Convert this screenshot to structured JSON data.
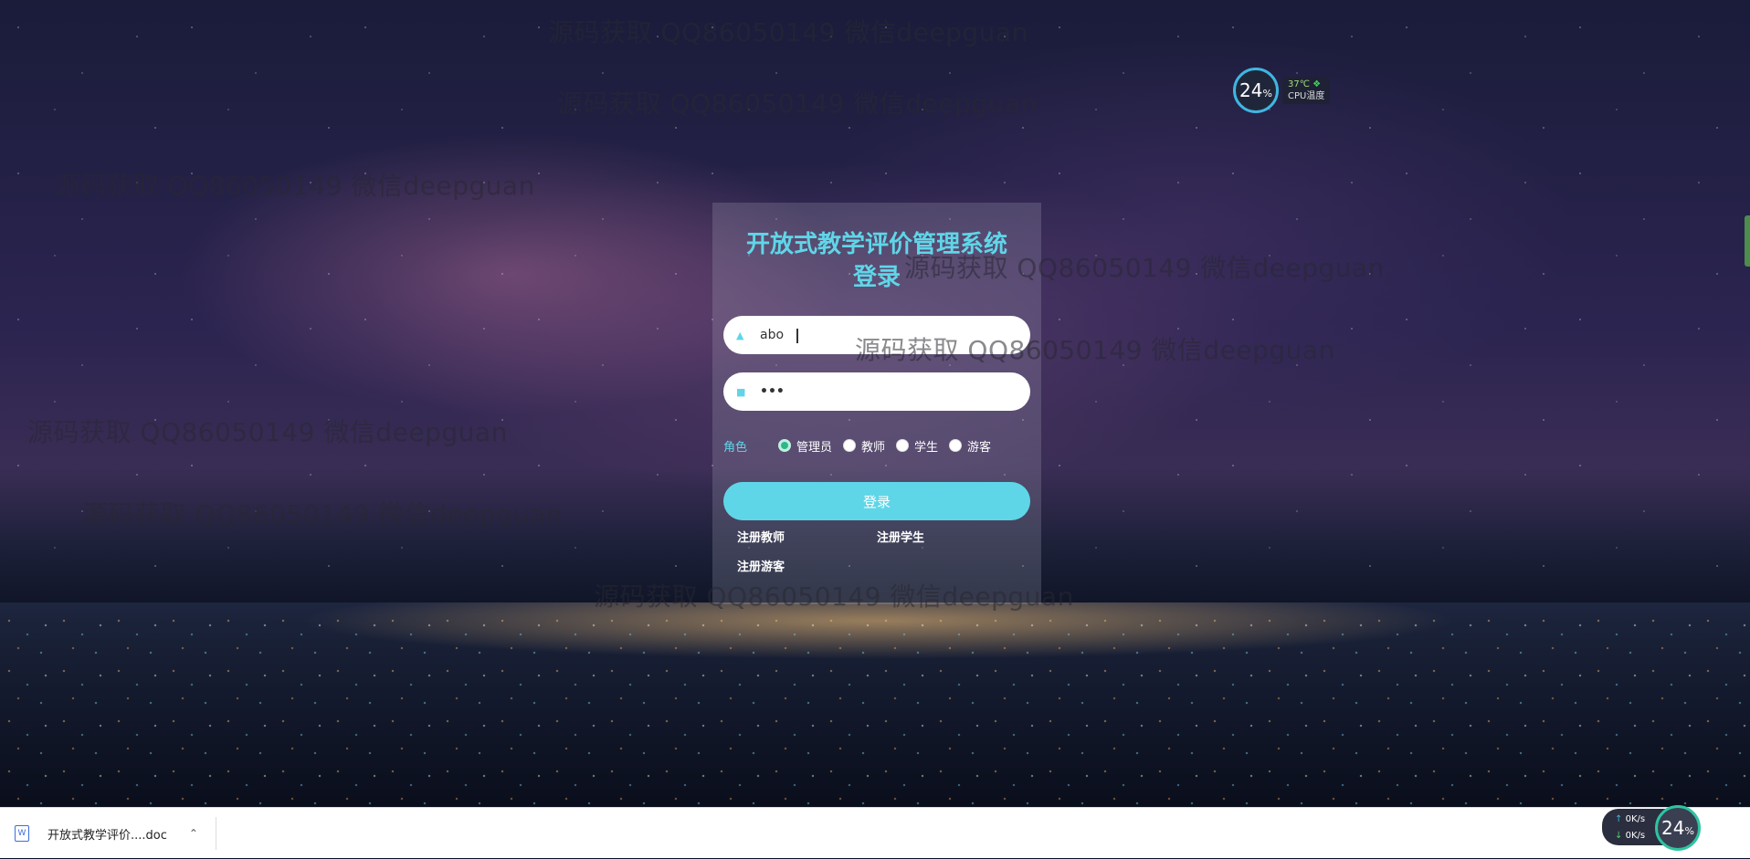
{
  "app": {
    "title_line1": "开放式教学评价管理系统",
    "title_line2": "登录"
  },
  "form": {
    "username_value": "abo",
    "password_value": "•••",
    "role_label": "角色",
    "roles": [
      "管理员",
      "教师",
      "学生",
      "游客"
    ],
    "selected_role": "管理员",
    "login_button": "登录",
    "links": {
      "register_teacher": "注册教师",
      "register_student": "注册学生",
      "register_guest": "注册游客"
    }
  },
  "cpu_widget": {
    "usage": "24",
    "usage_unit": "%",
    "temp": "37℃",
    "temp_label": "CPU温度"
  },
  "watermarks": [
    "源码获取 QQ86050149 微信deepguan",
    "源码获取 QQ86050149 微信deepguan",
    "源码获取 QQ86050149 微信deepguan",
    "源码获取 QQ86050149 微信deepguan",
    "源码获取 QQ86050149 微信deepguan",
    "源码获取 QQ86050149 微信deepguan",
    "源码获取 QQ86050149 微信deepguan",
    "源码获取 QQ86050149 微信deepguan"
  ],
  "download_bar": {
    "file_name": "开放式教学评价....doc",
    "net_up": "0",
    "net_down": "0",
    "net_unit": "K/s",
    "usage": "24",
    "usage_unit": "%"
  },
  "colors": {
    "accent": "#5fd6e8",
    "selected_radio": "#2eb88a"
  }
}
